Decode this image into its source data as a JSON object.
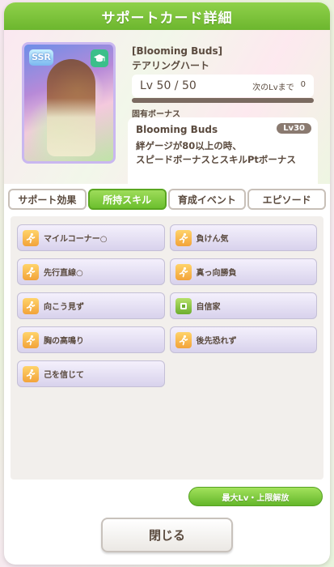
{
  "title": "サポートカード詳細",
  "card": {
    "rarity": "SSR",
    "type_icon": "graduation-cap-icon",
    "title": "[Blooming Buds]",
    "name": "テアリングハート",
    "level": "Lv 50 / 50",
    "next_level_label": "次のLvまで",
    "next_level_value": "0"
  },
  "unique_bonus": {
    "heading": "固有ボーナス",
    "name": "Blooming Buds",
    "level": "Lv30",
    "description_line1": "絆ゲージが80以上の時、",
    "description_line2": "スピードボーナスとスキルPtボーナス"
  },
  "tabs": [
    {
      "label": "サポート効果",
      "active": false
    },
    {
      "label": "所持スキル",
      "active": true
    },
    {
      "label": "育成イベント",
      "active": false
    },
    {
      "label": "エピソード",
      "active": false
    }
  ],
  "skills": [
    {
      "label": "マイルコーナー○",
      "icon": "runner-icon",
      "color": "#f2a33a"
    },
    {
      "label": "負けん気",
      "icon": "runner-icon",
      "color": "#f2a33a"
    },
    {
      "label": "先行直線○",
      "icon": "runner-icon",
      "color": "#f2a33a"
    },
    {
      "label": "真っ向勝負",
      "icon": "runner-icon",
      "color": "#f2a33a"
    },
    {
      "label": "向こう見ず",
      "icon": "runner-icon",
      "color": "#f2a33a"
    },
    {
      "label": "自信家",
      "icon": "stamina-icon",
      "color": "#6cae2e"
    },
    {
      "label": "胸の高鳴り",
      "icon": "runner-icon",
      "color": "#f2a33a"
    },
    {
      "label": "後先恐れず",
      "icon": "runner-icon",
      "color": "#f2a33a"
    },
    {
      "label": "己を信じて",
      "icon": "runner-icon",
      "color": "#f2a33a"
    }
  ],
  "buttons": {
    "max_level": "最大Lv・上限解放",
    "close": "閉じる"
  }
}
